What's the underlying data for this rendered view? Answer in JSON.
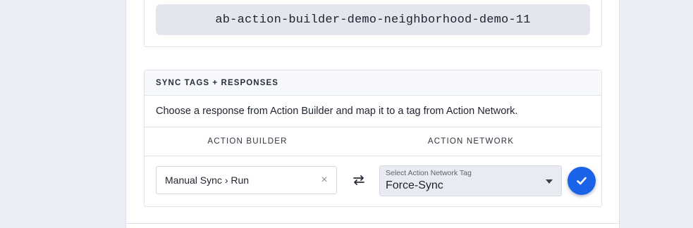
{
  "slug": {
    "value": "ab-action-builder-demo-neighborhood-demo-11"
  },
  "sync": {
    "title": "SYNC TAGS + RESPONSES",
    "description": "Choose a response from Action Builder and map it to a tag from Action Network.",
    "columns": {
      "action_builder": "ACTION BUILDER",
      "action_network": "ACTION NETWORK"
    },
    "mapping": {
      "action_builder_value": "Manual Sync › Run",
      "clear_glyph": "×",
      "action_network_label": "Select Action Network Tag",
      "action_network_value": "Force-Sync"
    }
  },
  "colors": {
    "background": "#ebedf5",
    "accent": "#1a62e8",
    "select_bg": "#e9ebf2",
    "slug_bg": "#e4e6ee"
  },
  "icons": {
    "swap": "swap-arrows-icon",
    "clear": "close-icon",
    "dropdown": "caret-down-icon",
    "confirm": "checkmark-icon"
  }
}
